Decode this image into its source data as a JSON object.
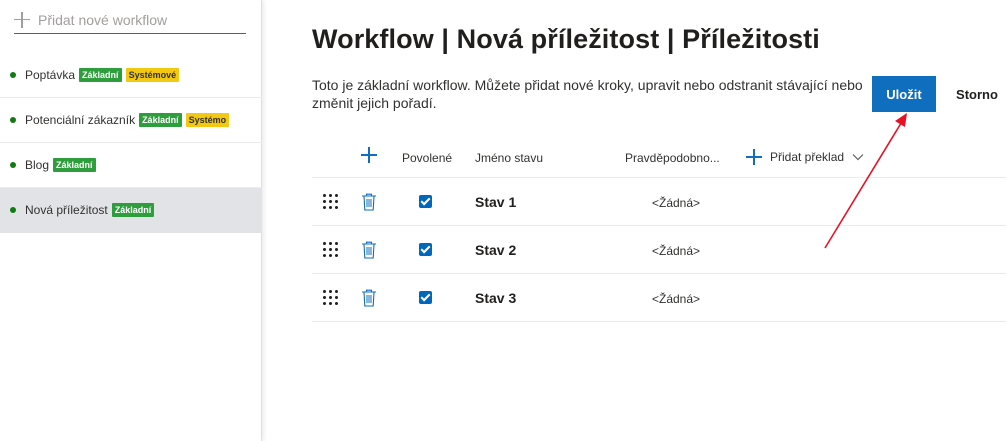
{
  "sidebar": {
    "add_workflow_placeholder": "Přidat nové workflow",
    "items": [
      {
        "name": "Poptávka",
        "badges": [
          "Základní",
          "Systémové"
        ]
      },
      {
        "name": "Potenciální zákazník",
        "badges": [
          "Základní",
          "Systémo"
        ]
      },
      {
        "name": "Blog",
        "badges": [
          "Základní"
        ]
      },
      {
        "name": "Nová příležitost",
        "badges": [
          "Základní"
        ],
        "selected": true
      }
    ]
  },
  "main": {
    "title": "Workflow | Nová příležitost | Příležitosti",
    "description": "Toto je základní workflow. Můžete přidat nové kroky, upravit nebo odstranit stávající nebo změnit jejich pořadí.",
    "save_label": "Uložit",
    "cancel_label": "Storno",
    "columns": {
      "enabled": "Povolené",
      "state_name": "Jméno stavu",
      "probability": "Pravděpodobno...",
      "add_translation": "Přidat překlad"
    },
    "rows": [
      {
        "name": "Stav 1",
        "enabled": true,
        "probability": "<Žádná>"
      },
      {
        "name": "Stav 2",
        "enabled": true,
        "probability": "<Žádná>"
      },
      {
        "name": "Stav 3",
        "enabled": true,
        "probability": "<Žádná>"
      }
    ]
  },
  "colors": {
    "accent": "#106ebe",
    "badge_green": "#2e9e3c",
    "badge_yellow": "#f2c811",
    "status_dot": "#107c10",
    "annotation_arrow": "#e81123"
  },
  "icons": [
    "plus-icon",
    "drag-grip-icon",
    "trash-icon",
    "checkbox-checked-icon",
    "chevron-down-icon",
    "arrow-annotation"
  ]
}
